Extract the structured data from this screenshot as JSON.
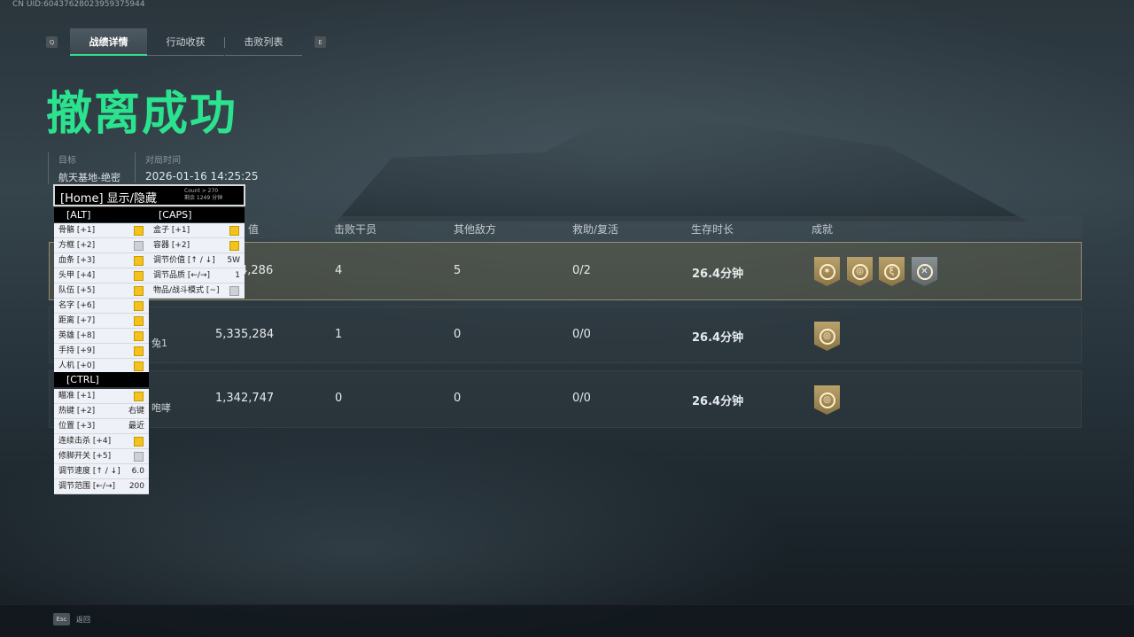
{
  "uid_text": "CN UID:6043762802395937594­4",
  "tabs": {
    "left_key": "Q",
    "right_key": "E",
    "items": [
      {
        "label": "战绩详情"
      },
      {
        "label": "行动收获"
      },
      {
        "label": "击败列表"
      }
    ]
  },
  "headline": "撤离成功",
  "info": {
    "target_label": "目标",
    "target_value": "航天基地-绝密",
    "time_label": "对局时间",
    "time_value": "2026-01-16 14:25:25"
  },
  "table": {
    "columns": [
      "值",
      "击败干员",
      "其他敌方",
      "救助/复活",
      "生存时长",
      "成就"
    ],
    "rows": [
      {
        "name": "",
        "value": "4,286",
        "kills": "4",
        "others": "5",
        "revive": "0/2",
        "duration": "26.4分钟",
        "badges": [
          "sun-emblem-icon",
          "circle-emblem-icon",
          "caduceus-emblem-icon",
          "crossed-arrows-emblem-icon"
        ]
      },
      {
        "name": "兔1",
        "value": "5,335,284",
        "kills": "1",
        "others": "0",
        "revive": "0/0",
        "duration": "26.4分钟",
        "badges": [
          "circle-emblem-icon"
        ]
      },
      {
        "name": "咆哮",
        "value": "1,342,747",
        "kills": "0",
        "others": "0",
        "revive": "0/0",
        "duration": "26.4分钟",
        "badges": [
          "circle-emblem-icon"
        ]
      }
    ]
  },
  "overlay": {
    "title": "[Home] 显示/隐藏",
    "count_line1": "Count > 270",
    "count_line2": "剩余 1249 分钟",
    "alt_label": "[ALT]",
    "caps_label": "[CAPS]",
    "ctrl_label": "[CTRL]",
    "alt_items": [
      {
        "label": "骨骼 [+1]",
        "checked": true
      },
      {
        "label": "方框 [+2]",
        "checked": false
      },
      {
        "label": "血条 [+3]",
        "checked": true
      },
      {
        "label": "头甲 [+4]",
        "checked": true
      },
      {
        "label": "队伍 [+5]",
        "checked": true
      },
      {
        "label": "名字 [+6]",
        "checked": true
      },
      {
        "label": "距离 [+7]",
        "checked": true
      },
      {
        "label": "英雄 [+8]",
        "checked": true
      },
      {
        "label": "手持 [+9]",
        "checked": true
      },
      {
        "label": "人机 [+0]",
        "checked": true
      }
    ],
    "caps_items": [
      {
        "label": "盒子 [+1]",
        "checked": true,
        "value": ""
      },
      {
        "label": "容器 [+2]",
        "checked": true,
        "value": ""
      },
      {
        "label": "调节价值 [↑ / ↓]",
        "checked": null,
        "value": "5W"
      },
      {
        "label": "调节品质 [←/→]",
        "checked": null,
        "value": "1"
      },
      {
        "label": "物品/战斗模式 [~]",
        "checked": false,
        "value": ""
      }
    ],
    "ctrl_items": [
      {
        "label": "瞄准 [+1]",
        "checked": true,
        "value": ""
      },
      {
        "label": "热键 [+2]",
        "checked": null,
        "value": "右键"
      },
      {
        "label": "位置 [+3]",
        "checked": null,
        "value": "最近"
      },
      {
        "label": "连续击杀 [+4]",
        "checked": true,
        "value": ""
      },
      {
        "label": "修脚开关 [+5]",
        "checked": false,
        "value": ""
      },
      {
        "label": "调节速度 [↑ / ↓]",
        "checked": null,
        "value": "6.0"
      },
      {
        "label": "调节范围 [←/→]",
        "checked": null,
        "value": "200"
      }
    ]
  },
  "footer": {
    "esc_key": "Esc",
    "esc_label": "返回"
  }
}
